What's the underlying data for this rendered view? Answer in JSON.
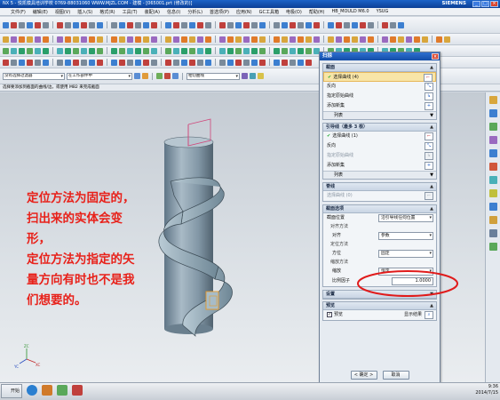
{
  "window": {
    "title": "NX 5 - 悦凯模具培训学校  0769-88031060  WWW.MJZL.COM - 建模 - [065001.prt (修改的)]",
    "brand": "SIEMENS"
  },
  "menu": [
    "文件(F)",
    "编辑(E)",
    "视图(V)",
    "插入(S)",
    "格式(R)",
    "工具(T)",
    "装配(A)",
    "信息(I)",
    "分析(L)",
    "首选项(P)",
    "应用(N)",
    "GC工具箱",
    "电极(O)",
    "帮助(H)",
    "HB_MOULD M6.0",
    "YSUG"
  ],
  "filters": {
    "selection": "没有选择过滤器",
    "scope": "在工作部件中",
    "snap": "相切曲线"
  },
  "status_text": "选择要添加到截面的曲线/边，或使用 MB2 来完成截面",
  "overlay_text": [
    "定位方法为固定的，",
    "扫出来的实体会变",
    "形，",
    "定位方法为指定的矢",
    "量方向有时也不是我",
    "们想要的。"
  ],
  "dialog": {
    "title": "扫掠",
    "section": {
      "header": "截面",
      "select_curve": "选择曲线 (4)",
      "reverse": "反向",
      "specify_origin_curve": "指定原始曲线",
      "add_new_set": "添加新集",
      "list": "列表"
    },
    "guide": {
      "header": "引导线（最多 3 根）",
      "select_curve": "选择曲线 (1)",
      "reverse": "反向",
      "specify_origin_curve": "指定原始曲线",
      "add_new_set": "添加新集",
      "list": "列表"
    },
    "spine": {
      "header": "脊线",
      "select_curve": "选择曲线 (0)"
    },
    "section_options": {
      "header": "截面选项",
      "section_location_label": "截面位置",
      "section_location_value": "沿引导线任何位置",
      "alignment_method_header": "对齐方法",
      "alignment_label": "对齐",
      "alignment_value": "参数",
      "orientation_method_header": "定位方法",
      "orientation_label": "方位",
      "orientation_value": "固定",
      "scaling_method_header": "缩放方法",
      "scaling_label": "缩放",
      "scaling_value": "恒定",
      "scale_factor_label": "比例因子",
      "scale_factor_value": "1.0000"
    },
    "settings_header": "设置",
    "preview_header": "预览",
    "preview_checkbox": "预览",
    "show_result": "显示结果",
    "ok": "< 确定 >",
    "cancel": "取消"
  },
  "clock": {
    "time": "9:36",
    "date": "2014/7/15"
  },
  "start_label": "开始"
}
